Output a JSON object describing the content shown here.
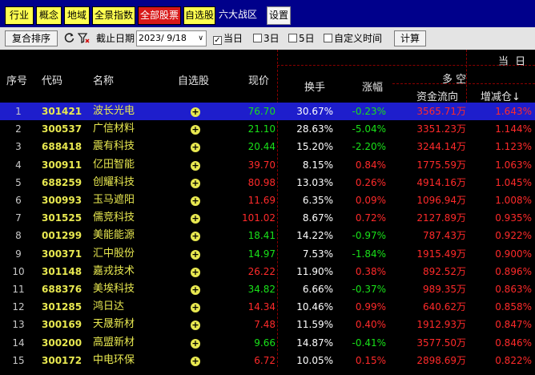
{
  "tabs": [
    {
      "label": "行业",
      "style": "tab"
    },
    {
      "label": "概念",
      "style": "tab"
    },
    {
      "label": "地域",
      "style": "tab"
    },
    {
      "label": "全景指数",
      "style": "tab"
    },
    {
      "label": "全部股票",
      "style": "active"
    },
    {
      "label": "自选股",
      "style": "tab"
    },
    {
      "label": "六大战区",
      "style": "plain"
    },
    {
      "label": "设置",
      "style": "settings"
    }
  ],
  "toolbar": {
    "sort_button": "复合排序",
    "refresh_icon": "refresh-icon",
    "filter_icon": "filter-clear-icon",
    "date_label": "截止日期",
    "date_value": "2023/ 9/18",
    "options": [
      {
        "label": "当日",
        "checked": true
      },
      {
        "label": "3日",
        "checked": false
      },
      {
        "label": "5日",
        "checked": false
      },
      {
        "label": "自定义时间",
        "checked": false
      }
    ],
    "calc_button": "计算"
  },
  "header": {
    "idx": "序号",
    "code": "代码",
    "name": "名称",
    "watch": "自选股",
    "price": "现价",
    "turnover": "换手",
    "change": "涨幅",
    "today": "当 日",
    "long_short": "多 空",
    "flow": "资金流向",
    "position": "增减仓↓"
  },
  "rows": [
    {
      "idx": "1",
      "code": "301421",
      "name": "波长光电",
      "price": "76.70",
      "turnover": "30.67%",
      "change": "-0.23%",
      "flow": "3565.71万",
      "position": "1.643%",
      "trend": "down",
      "price_color": "green"
    },
    {
      "idx": "2",
      "code": "300537",
      "name": "广信材料",
      "price": "21.10",
      "turnover": "28.63%",
      "change": "-5.04%",
      "flow": "3351.23万",
      "position": "1.144%",
      "trend": "down",
      "price_color": "green"
    },
    {
      "idx": "3",
      "code": "688418",
      "name": "震有科技",
      "price": "20.44",
      "turnover": "15.20%",
      "change": "-2.20%",
      "flow": "3244.14万",
      "position": "1.123%",
      "trend": "down",
      "price_color": "green"
    },
    {
      "idx": "4",
      "code": "300911",
      "name": "亿田智能",
      "price": "39.70",
      "turnover": "8.15%",
      "change": "0.84%",
      "flow": "1775.59万",
      "position": "1.063%",
      "trend": "up",
      "price_color": "red"
    },
    {
      "idx": "5",
      "code": "688259",
      "name": "创耀科技",
      "price": "80.98",
      "turnover": "13.03%",
      "change": "0.26%",
      "flow": "4914.16万",
      "position": "1.045%",
      "trend": "up",
      "price_color": "red"
    },
    {
      "idx": "6",
      "code": "300993",
      "name": "玉马遮阳",
      "price": "11.69",
      "turnover": "6.35%",
      "change": "0.09%",
      "flow": "1096.94万",
      "position": "1.008%",
      "trend": "up",
      "price_color": "red"
    },
    {
      "idx": "7",
      "code": "301525",
      "name": "儒竞科技",
      "price": "101.02",
      "turnover": "8.67%",
      "change": "0.72%",
      "flow": "2127.89万",
      "position": "0.935%",
      "trend": "up",
      "price_color": "red"
    },
    {
      "idx": "8",
      "code": "001299",
      "name": "美能能源",
      "price": "18.41",
      "turnover": "14.22%",
      "change": "-0.97%",
      "flow": "787.43万",
      "position": "0.922%",
      "trend": "down",
      "price_color": "green"
    },
    {
      "idx": "9",
      "code": "300371",
      "name": "汇中股份",
      "price": "14.97",
      "turnover": "7.53%",
      "change": "-1.84%",
      "flow": "1915.49万",
      "position": "0.900%",
      "trend": "down",
      "price_color": "green"
    },
    {
      "idx": "10",
      "code": "301148",
      "name": "嘉戎技术",
      "price": "26.22",
      "turnover": "11.90%",
      "change": "0.38%",
      "flow": "892.52万",
      "position": "0.896%",
      "trend": "up",
      "price_color": "red"
    },
    {
      "idx": "11",
      "code": "688376",
      "name": "美埃科技",
      "price": "34.82",
      "turnover": "6.66%",
      "change": "-0.37%",
      "flow": "989.35万",
      "position": "0.863%",
      "trend": "down",
      "price_color": "green"
    },
    {
      "idx": "12",
      "code": "301285",
      "name": "鸿日达",
      "price": "14.34",
      "turnover": "10.46%",
      "change": "0.99%",
      "flow": "640.62万",
      "position": "0.858%",
      "trend": "up",
      "price_color": "red"
    },
    {
      "idx": "13",
      "code": "300169",
      "name": "天晟新材",
      "price": "7.48",
      "turnover": "11.59%",
      "change": "0.40%",
      "flow": "1912.93万",
      "position": "0.847%",
      "trend": "up",
      "price_color": "red"
    },
    {
      "idx": "14",
      "code": "300200",
      "name": "高盟新材",
      "price": "9.66",
      "turnover": "14.87%",
      "change": "-0.41%",
      "flow": "3577.50万",
      "position": "0.846%",
      "trend": "down",
      "price_color": "green"
    },
    {
      "idx": "15",
      "code": "300172",
      "name": "中电环保",
      "price": "6.72",
      "turnover": "10.05%",
      "change": "0.15%",
      "flow": "2898.69万",
      "position": "0.822%",
      "trend": "up",
      "price_color": "red"
    }
  ],
  "selected_row": 0,
  "colors": {
    "tabbar": "#00008b",
    "tab": "#ffff50",
    "tab_active": "#d81818",
    "selected_row": "#1e1ecc",
    "up": "#ff2a2a",
    "down": "#19e119",
    "code": "#e8e850",
    "divider": "#8b0000"
  }
}
